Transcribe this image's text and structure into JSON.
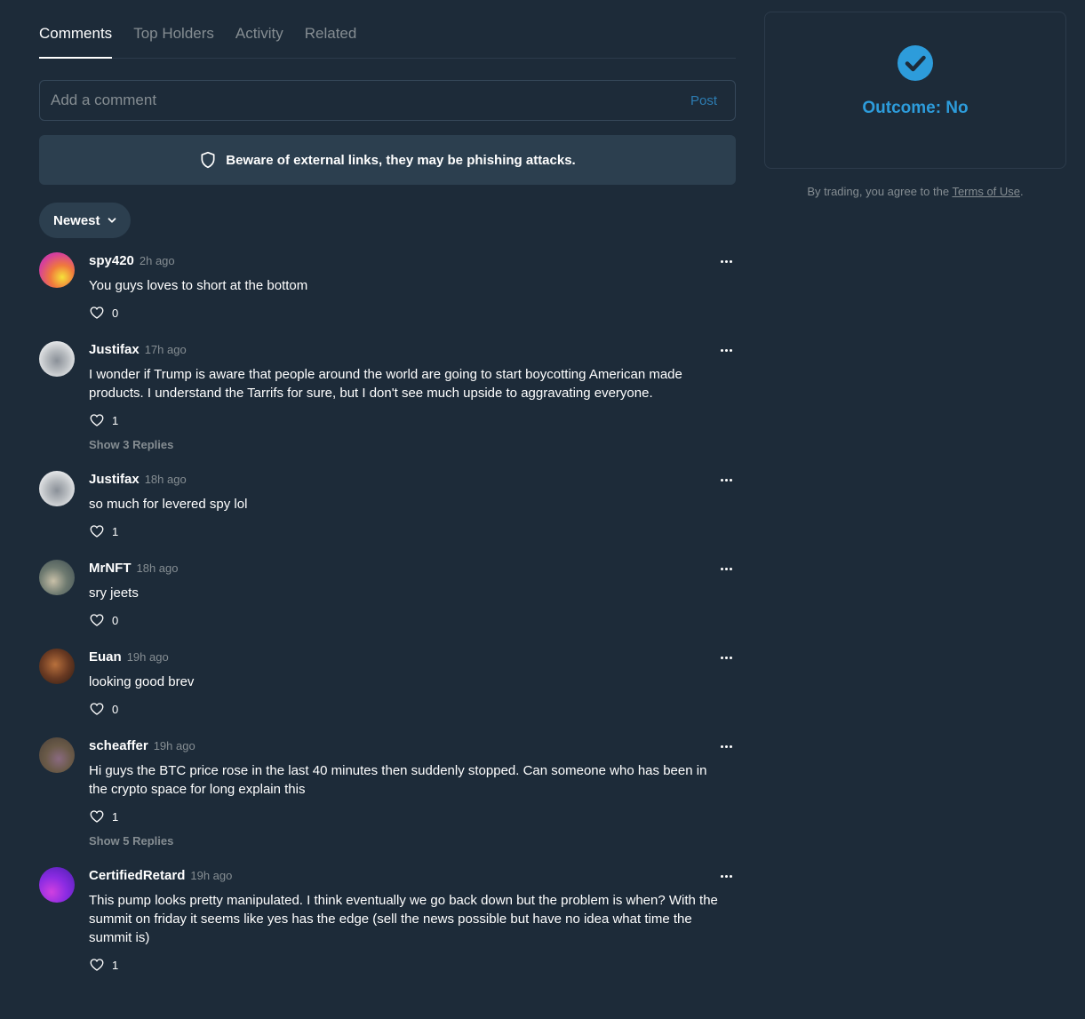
{
  "tabs": [
    {
      "label": "Comments",
      "active": true
    },
    {
      "label": "Top Holders",
      "active": false
    },
    {
      "label": "Activity",
      "active": false
    },
    {
      "label": "Related",
      "active": false
    }
  ],
  "comment_input": {
    "placeholder": "Add a comment",
    "post_label": "Post"
  },
  "warning": {
    "text": "Beware of external links, they may be phishing attacks.",
    "icon": "shield-icon"
  },
  "sort": {
    "label": "Newest",
    "icon": "chevron-down-icon"
  },
  "comments": [
    {
      "name": "spy420",
      "time": "2h ago",
      "text": "You guys loves to short at the bottom",
      "likes": "0",
      "replies": "",
      "avatar_color": "#e04b8a"
    },
    {
      "name": "Justifax",
      "time": "17h ago",
      "text": "I wonder if Trump is aware that people around the world are going to start boycotting American made products. I understand the Tarrifs for sure, but I don't see much upside to aggravating everyone.",
      "likes": "1",
      "replies": "Show 3 Replies",
      "avatar_color": "#d9dde0"
    },
    {
      "name": "Justifax",
      "time": "18h ago",
      "text": "so much for levered spy lol",
      "likes": "1",
      "replies": "",
      "avatar_color": "#d9dde0"
    },
    {
      "name": "MrNFT",
      "time": "18h ago",
      "text": "sry jeets",
      "likes": "0",
      "replies": "",
      "avatar_color": "#7a8a86"
    },
    {
      "name": "Euan",
      "time": "19h ago",
      "text": "looking good brev",
      "likes": "0",
      "replies": "",
      "avatar_color": "#6a3a28"
    },
    {
      "name": "scheaffer",
      "time": "19h ago",
      "text": "Hi guys the BTC price rose in the last 40 minutes then suddenly stopped. Can someone who has been in the crypto space for long explain this",
      "likes": "1",
      "replies": "Show 5 Replies",
      "avatar_color": "#5a5048"
    },
    {
      "name": "CertifiedRetard",
      "time": "19h ago",
      "text": "This pump looks pretty manipulated. I think eventually we go back down but the problem is when? With the summit on friday it seems like yes has the edge (sell the news possible but have no idea what time the summit is)",
      "likes": "1",
      "replies": "",
      "avatar_color": "#8a2be2"
    }
  ],
  "outcome": {
    "text": "Outcome: No",
    "icon": "check-circle-icon",
    "color": "#2d9cdb"
  },
  "terms": {
    "prefix": "By trading, you agree to the ",
    "link": "Terms of Use",
    "suffix": "."
  },
  "colors": {
    "background": "#1d2b39",
    "panel": "#2c3f4f",
    "muted": "#858d92",
    "accent": "#2d9cdb"
  }
}
